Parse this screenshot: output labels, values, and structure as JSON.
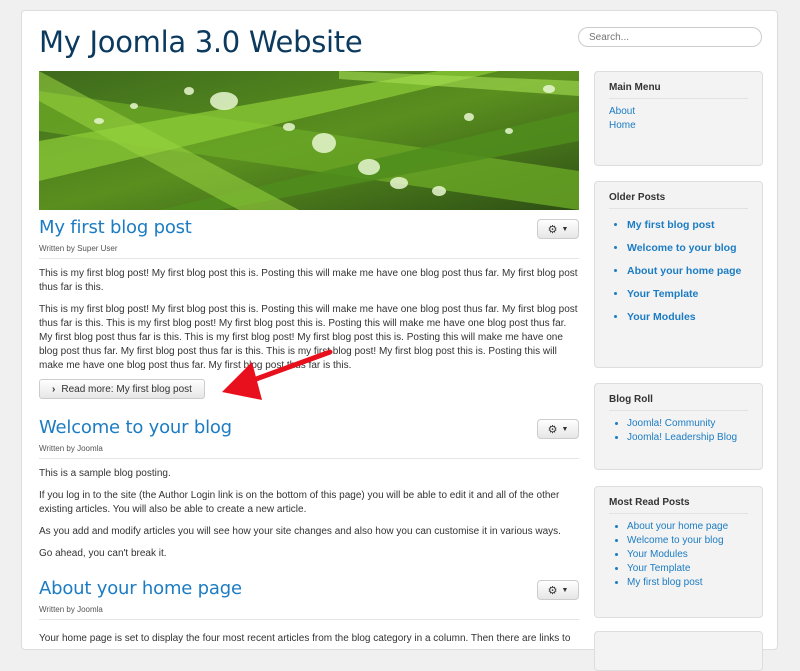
{
  "header": {
    "site_title": "My Joomla 3.0 Website",
    "search_placeholder": "Search..."
  },
  "articles": [
    {
      "title": "My first blog post",
      "author": "Written by Super User",
      "paragraphs": [
        "This is my first blog post! My first blog post this is. Posting this will make me have one blog post thus far. My first blog post thus far is this.",
        "This is my first blog post! My first blog post this is. Posting this will make me have one blog post thus far. My first blog post thus far is this. This is my first blog post! My first blog post this is. Posting this will make me have one blog post thus far. My first blog post thus far is this. This is my first blog post! My first blog post this is. Posting this will make me have one blog post thus far. My first blog post thus far is this. This is my first blog post! My first blog post this is. Posting this will make me have one blog post thus far. My first blog post thus far is this."
      ],
      "read_more": "Read more: My first blog post"
    },
    {
      "title": "Welcome to your blog",
      "author": "Written by Joomla",
      "paragraphs": [
        "This is a sample blog posting.",
        "If you log in to the site (the Author Login link is on the bottom of this page) you will be able to edit it and all of the other existing articles. You will also be able to create a new article.",
        "As you add and modify articles you will see how your site changes and also how you can customise it in various ways.",
        "Go ahead, you can't break it."
      ]
    },
    {
      "title": "About your home page",
      "author": "Written by Joomla",
      "paragraphs": [
        "Your home page is set to display the four most recent articles from the blog category in a column. Then there are links to"
      ]
    }
  ],
  "sidebar": {
    "main_menu": {
      "title": "Main Menu",
      "items": [
        "About",
        "Home"
      ]
    },
    "older_posts": {
      "title": "Older Posts",
      "items": [
        "My first blog post",
        "Welcome to your blog",
        "About your home page",
        "Your Template",
        "Your Modules"
      ]
    },
    "blog_roll": {
      "title": "Blog Roll",
      "items": [
        "Joomla! Community",
        "Joomla! Leadership Blog"
      ]
    },
    "most_read": {
      "title": "Most Read Posts",
      "items": [
        "About your home page",
        "Welcome to your blog",
        "Your Modules",
        "Your Template",
        "My first blog post"
      ]
    }
  },
  "icons": {
    "options": "gear-icon",
    "read_more": "chevron-right-icon",
    "annotation": "red-arrow"
  },
  "colors": {
    "title": "#0b3a5e",
    "link": "#1c7cc3",
    "arrow": "#e8101c"
  }
}
